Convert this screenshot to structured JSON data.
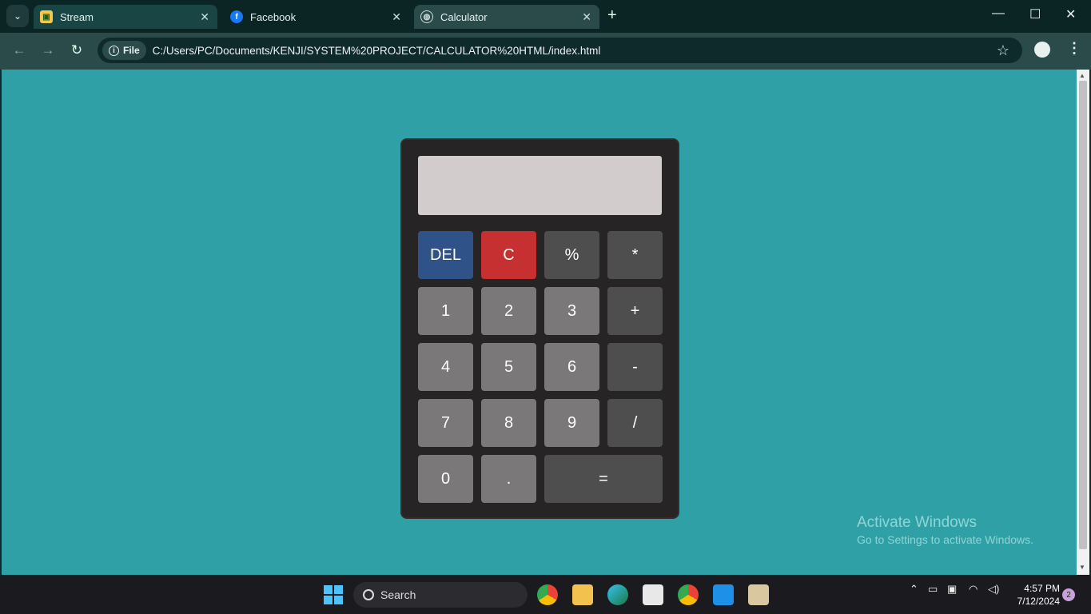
{
  "browser": {
    "tabs": [
      {
        "label": "Stream",
        "favicon": "stream-icon",
        "active": false
      },
      {
        "label": "Facebook",
        "favicon": "facebook-icon",
        "active": false
      },
      {
        "label": "Calculator",
        "favicon": "globe-icon",
        "active": true
      }
    ],
    "address_chip": "File",
    "url": "C:/Users/PC/Documents/KENJI/SYSTEM%20PROJECT/CALCULATOR%20HTML/index.html"
  },
  "calculator": {
    "display_value": "",
    "keys": {
      "del": "DEL",
      "clear": "C",
      "percent": "%",
      "multiply": "*",
      "one": "1",
      "two": "2",
      "three": "3",
      "plus": "+",
      "four": "4",
      "five": "5",
      "six": "6",
      "minus": "-",
      "seven": "7",
      "eight": "8",
      "nine": "9",
      "divide": "/",
      "zero": "0",
      "dot": ".",
      "equals": "="
    },
    "colors": {
      "page_bg": "#2fa1a6",
      "body": "#262424",
      "display": "#d3cccc",
      "del": "#2f5289",
      "clear": "#c63030",
      "operator": "#4e4e4e",
      "number": "#7a7878"
    }
  },
  "watermark": {
    "title": "Activate Windows",
    "subtitle": "Go to Settings to activate Windows."
  },
  "taskbar": {
    "search_label": "Search",
    "time": "4:57 PM",
    "date": "7/12/2024",
    "notification_count": "2"
  }
}
